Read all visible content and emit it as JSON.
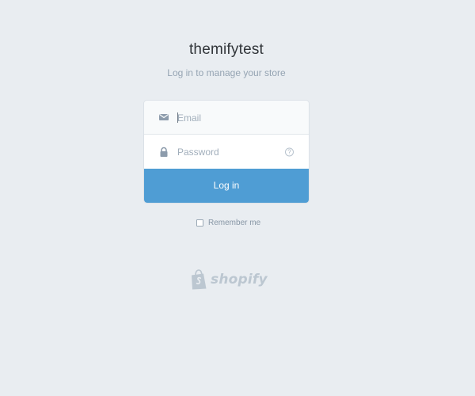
{
  "header": {
    "store_name": "themifytest",
    "subtitle": "Log in to manage your store"
  },
  "form": {
    "email_placeholder": "Email",
    "email_value": "",
    "password_placeholder": "Password",
    "password_value": "",
    "help_glyph": "?",
    "submit_label": "Log in",
    "remember_label": "Remember me",
    "remember_checked": false
  },
  "icons": {
    "email": "envelope-icon",
    "password": "lock-icon",
    "help": "question-circle-icon",
    "logo": "shopify-bag-icon"
  },
  "footer": {
    "brand_wordmark": "shopify"
  },
  "colors": {
    "background": "#e9edf1",
    "primary_button": "#4f9dd4",
    "title": "#32363a",
    "muted_text": "#95a4b3",
    "logo": "#bcc7d1"
  }
}
